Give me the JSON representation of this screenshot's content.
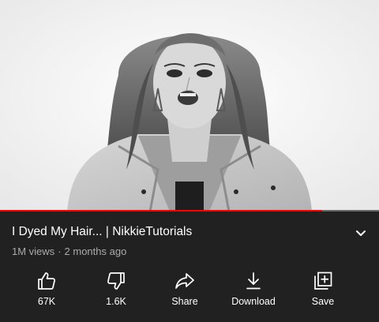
{
  "video": {
    "title": "I Dyed My Hair... | NikkieTutorials",
    "views": "1M views",
    "separator": "·",
    "age": "2 months ago",
    "progress": 0.85,
    "progress_color": "#ff0000"
  },
  "actions": [
    {
      "label": "67K",
      "icon": "thumbs-up-icon"
    },
    {
      "label": "1.6K",
      "icon": "thumbs-down-icon"
    },
    {
      "label": "Share",
      "icon": "share-icon"
    },
    {
      "label": "Download",
      "icon": "download-icon"
    },
    {
      "label": "Save",
      "icon": "save-to-playlist-icon"
    }
  ],
  "icons": {
    "expand": "chevron-down-icon"
  },
  "colors": {
    "background": "#212121",
    "text": "#ffffff",
    "secondary_text": "#aaaaaa"
  }
}
